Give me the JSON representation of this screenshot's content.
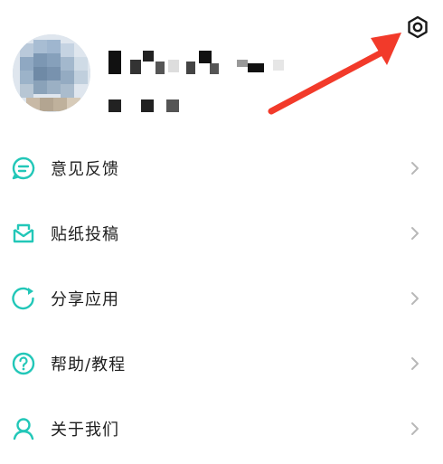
{
  "profile": {
    "avatar_icon": "avatar",
    "name_obscured": true,
    "id_obscured": true
  },
  "header": {
    "settings_icon": "gear-icon"
  },
  "menu": {
    "items": [
      {
        "label": "意见反馈",
        "icon": "feedback-chat-icon"
      },
      {
        "label": "贴纸投稿",
        "icon": "mail-envelope-icon"
      },
      {
        "label": "分享应用",
        "icon": "share-refresh-icon"
      },
      {
        "label": "帮助/教程",
        "icon": "help-question-icon"
      },
      {
        "label": "关于我们",
        "icon": "person-icon"
      }
    ]
  },
  "colors": {
    "accent": "#22C7B8",
    "annotation_arrow": "#F23A2A",
    "chevron": "#B8B8B8",
    "text": "#1E1E1E"
  }
}
